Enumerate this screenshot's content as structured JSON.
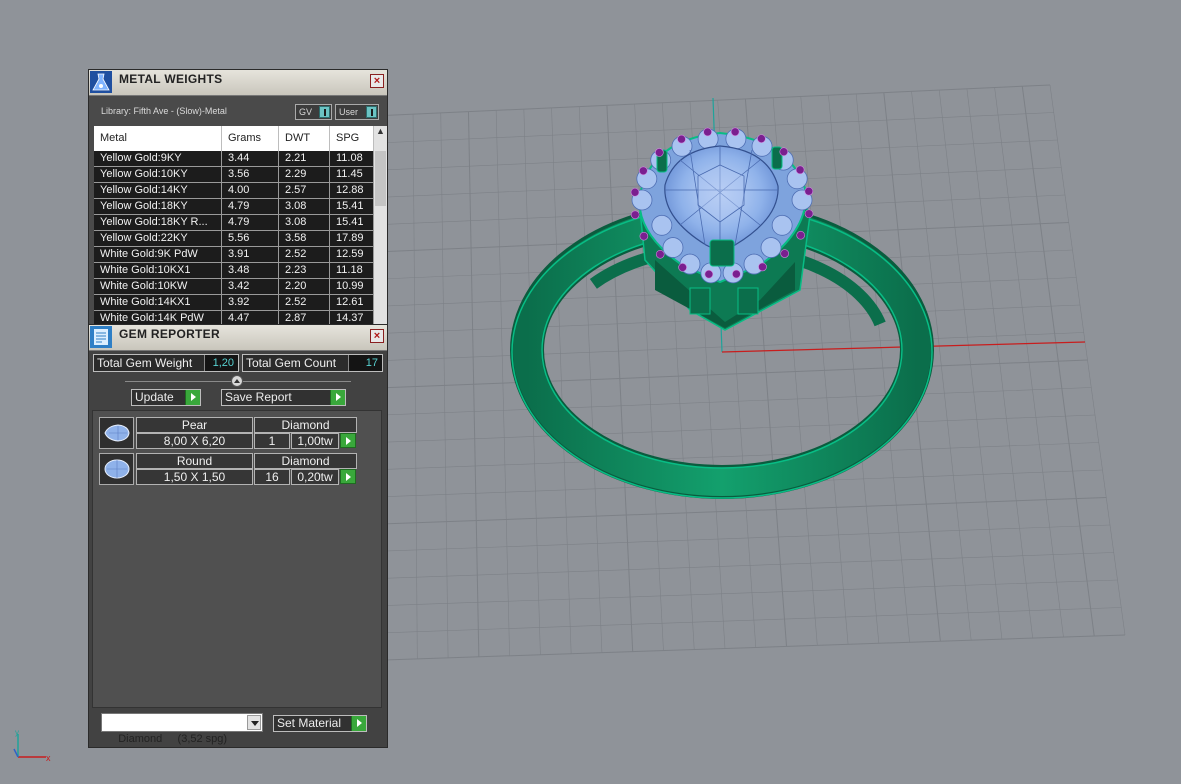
{
  "colors": {
    "background": "#8f9399",
    "grid": "#7d8187",
    "ring": "#0e8a5e",
    "gem": "#8fb2ea",
    "prong_accent": "#7a1f8f",
    "axis_x": "#c81d1d",
    "axis_y": "#1fa39a",
    "accent_button": "#39a83b",
    "value_text": "#57d2d2"
  },
  "metal_weights": {
    "title": "METAL WEIGHTS",
    "library": "Library: Fifth Ave - (Slow)-Metal",
    "toggles": {
      "gv": "GV",
      "user": "User"
    },
    "columns": [
      "Metal",
      "Grams",
      "DWT",
      "SPG"
    ],
    "rows": [
      [
        "Yellow Gold:9KY",
        "3.44",
        "2.21",
        "11.08"
      ],
      [
        "Yellow Gold:10KY",
        "3.56",
        "2.29",
        "11.45"
      ],
      [
        "Yellow Gold:14KY",
        "4.00",
        "2.57",
        "12.88"
      ],
      [
        "Yellow Gold:18KY",
        "4.79",
        "3.08",
        "15.41"
      ],
      [
        "Yellow Gold:18KY R...",
        "4.79",
        "3.08",
        "15.41"
      ],
      [
        "Yellow Gold:22KY",
        "5.56",
        "3.58",
        "17.89"
      ],
      [
        "White Gold:9K PdW",
        "3.91",
        "2.52",
        "12.59"
      ],
      [
        "White Gold:10KX1",
        "3.48",
        "2.23",
        "11.18"
      ],
      [
        "White Gold:10KW",
        "3.42",
        "2.20",
        "10.99"
      ],
      [
        "White Gold:14KX1",
        "3.92",
        "2.52",
        "12.61"
      ],
      [
        "White Gold:14K PdW",
        "4.47",
        "2.87",
        "14.37"
      ]
    ]
  },
  "gem_reporter": {
    "title": "GEM REPORTER",
    "total_gem_weight_label": "Total Gem Weight",
    "total_gem_weight": "1,20",
    "total_gem_count_label": "Total Gem Count",
    "total_gem_count": "17",
    "update_label": "Update",
    "save_report_label": "Save Report",
    "gems": [
      {
        "shape": "Pear",
        "material": "Diamond",
        "size": "8,00 X 6,20",
        "count": "1",
        "weight": "1,00tw"
      },
      {
        "shape": "Round",
        "material": "Diamond",
        "size": "1,50 X 1,50",
        "count": "16",
        "weight": "0,20tw"
      }
    ],
    "material": "Diamond     (3,52 spg)",
    "set_material_label": "Set Material"
  },
  "axes_icon": {
    "x": "x",
    "y": "y"
  }
}
